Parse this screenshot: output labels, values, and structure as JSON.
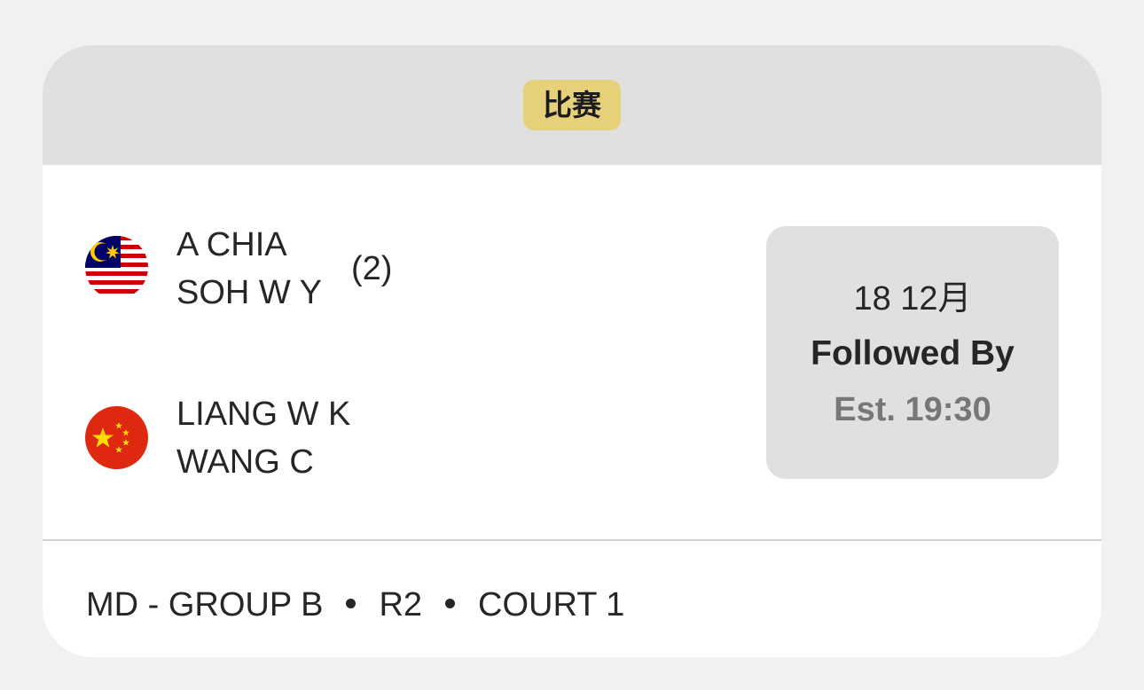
{
  "header": {
    "badge": "比赛"
  },
  "team1": {
    "flag": "malaysia-flag-icon",
    "player1": "A CHIA",
    "player2": "SOH W Y",
    "seed": "(2)"
  },
  "team2": {
    "flag": "china-flag-icon",
    "player1": "LIANG W K",
    "player2": "WANG C"
  },
  "schedule": {
    "date": "18 12月",
    "order": "Followed By",
    "estimate": "Est. 19:30"
  },
  "footer": {
    "event": "MD - GROUP B",
    "round": "R2",
    "court": "COURT 1"
  },
  "colors": {
    "page_bg": "#f1f1f1",
    "header_bg": "#e0e0e0",
    "badge_bg": "#e6d17a",
    "time_box_bg": "#e0e0e0",
    "text": "#262626",
    "muted": "#777777"
  }
}
